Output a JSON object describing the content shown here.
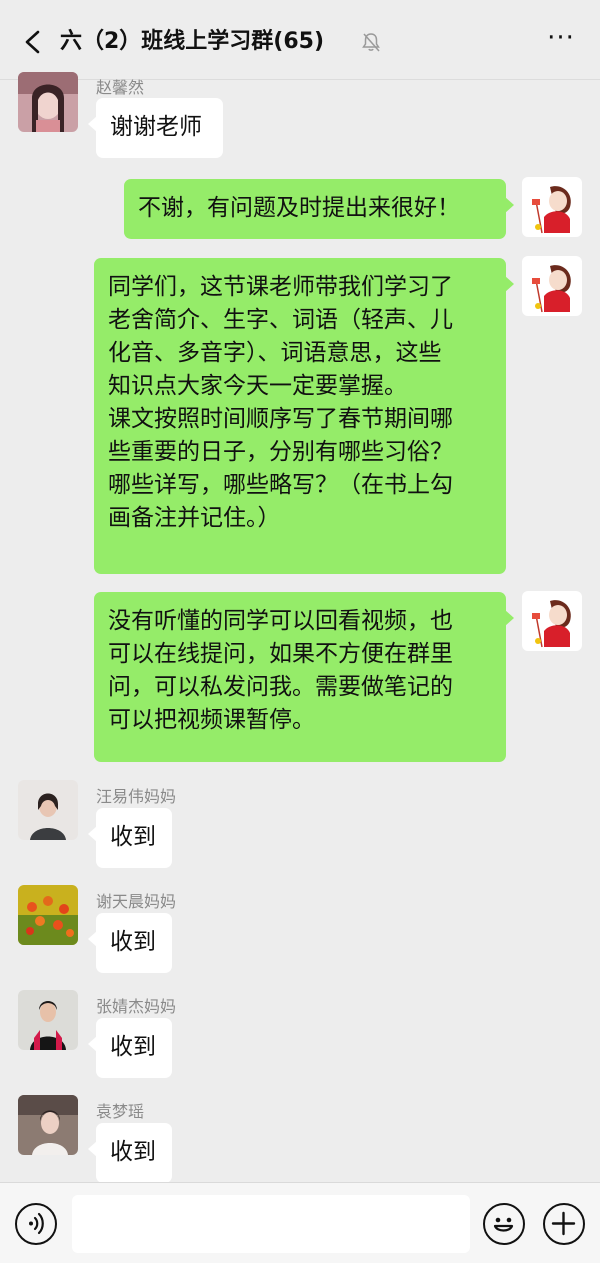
{
  "header": {
    "title": "六（2）班线上学习群(65)",
    "back_icon": "chevron-left-icon",
    "mute_icon": "bell-mute-icon",
    "more_label": "···"
  },
  "messages": [
    {
      "sender": "赵馨然",
      "text": "谢谢老师",
      "direction": "incoming"
    },
    {
      "text": "不谢，有问题及时提出来很好！",
      "direction": "outgoing"
    },
    {
      "direction": "outgoing",
      "lines": [
        "同学们，这节课老师带我们学习了",
        "老舍简介、生字、词语（轻声、儿",
        "化音、多音字）、词语意思，这些",
        "知识点大家今天一定要掌握。",
        "课文按照时间顺序写了春节期间哪",
        "些重要的日子，分别有哪些习俗？",
        "哪些详写，哪些略写？（在书上勾",
        "画备注并记住。）"
      ]
    },
    {
      "direction": "outgoing",
      "lines": [
        "没有听懂的同学可以回看视频，也",
        "可以在线提问，如果不方便在群里",
        "问，可以私发问我。需要做笔记的",
        "可以把视频课暂停。"
      ]
    },
    {
      "sender": "汪易伟妈妈",
      "text": "收到",
      "direction": "incoming"
    },
    {
      "sender": "谢天晨妈妈",
      "text": "收到",
      "direction": "incoming"
    },
    {
      "sender": "张婧杰妈妈",
      "text": "收到",
      "direction": "incoming"
    },
    {
      "sender": "袁梦瑶",
      "text": "收到",
      "direction": "incoming"
    }
  ],
  "bottom_bar": {
    "voice_icon": "voice-icon",
    "emoji_icon": "emoji-icon",
    "plus_icon": "plus-icon",
    "input_value": ""
  },
  "colors": {
    "background": "#ededed",
    "outgoing_bubble": "#95ec69",
    "incoming_bubble": "#ffffff"
  }
}
